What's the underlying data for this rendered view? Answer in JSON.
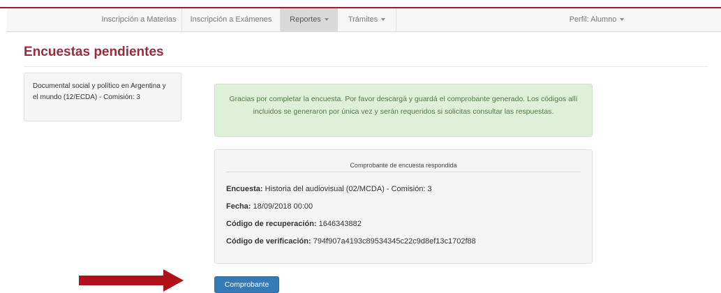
{
  "nav": {
    "items": [
      {
        "label": "Inscripción a Materias"
      },
      {
        "label": "Inscripción a Exámenes"
      },
      {
        "label": "Reportes"
      },
      {
        "label": "Trámites"
      }
    ],
    "active": "Reportes",
    "profile": "Perfil: Alumno"
  },
  "page": {
    "title": "Encuestas pendientes"
  },
  "sidebar": {
    "card_text": "Documental social y político en Argentina y el mundo (12/ECDA) - Comisión: 3"
  },
  "alert": {
    "text": "Gracias por completar la encuesta. Por favor descargá y guardá el comprobante generado. Los códigos allí incluidos se generaron por única vez y serán requeridos si solicitas consultar las respuestas."
  },
  "receipt": {
    "header": "Comprobante de encuesta respondida",
    "fields": [
      {
        "label": "Encuesta:",
        "value": "Historia del audiovisual (02/MCDA) - Comisión: 3"
      },
      {
        "label": "Fecha:",
        "value": "18/09/2018 00:00"
      },
      {
        "label": "Código de recuperación:",
        "value": "1646343882"
      },
      {
        "label": "Código de verificación:",
        "value": "794f907a4193c89534345c22c9d8ef13c1702f88"
      }
    ]
  },
  "button": {
    "label": "Comprobante"
  },
  "colors": {
    "brand": "#9c1b30",
    "title": "#9c2a3a",
    "alert_bg": "#dff0d8",
    "alert_text": "#4e7a45",
    "button_bg": "#337ab7",
    "arrow": "#b0101a"
  }
}
